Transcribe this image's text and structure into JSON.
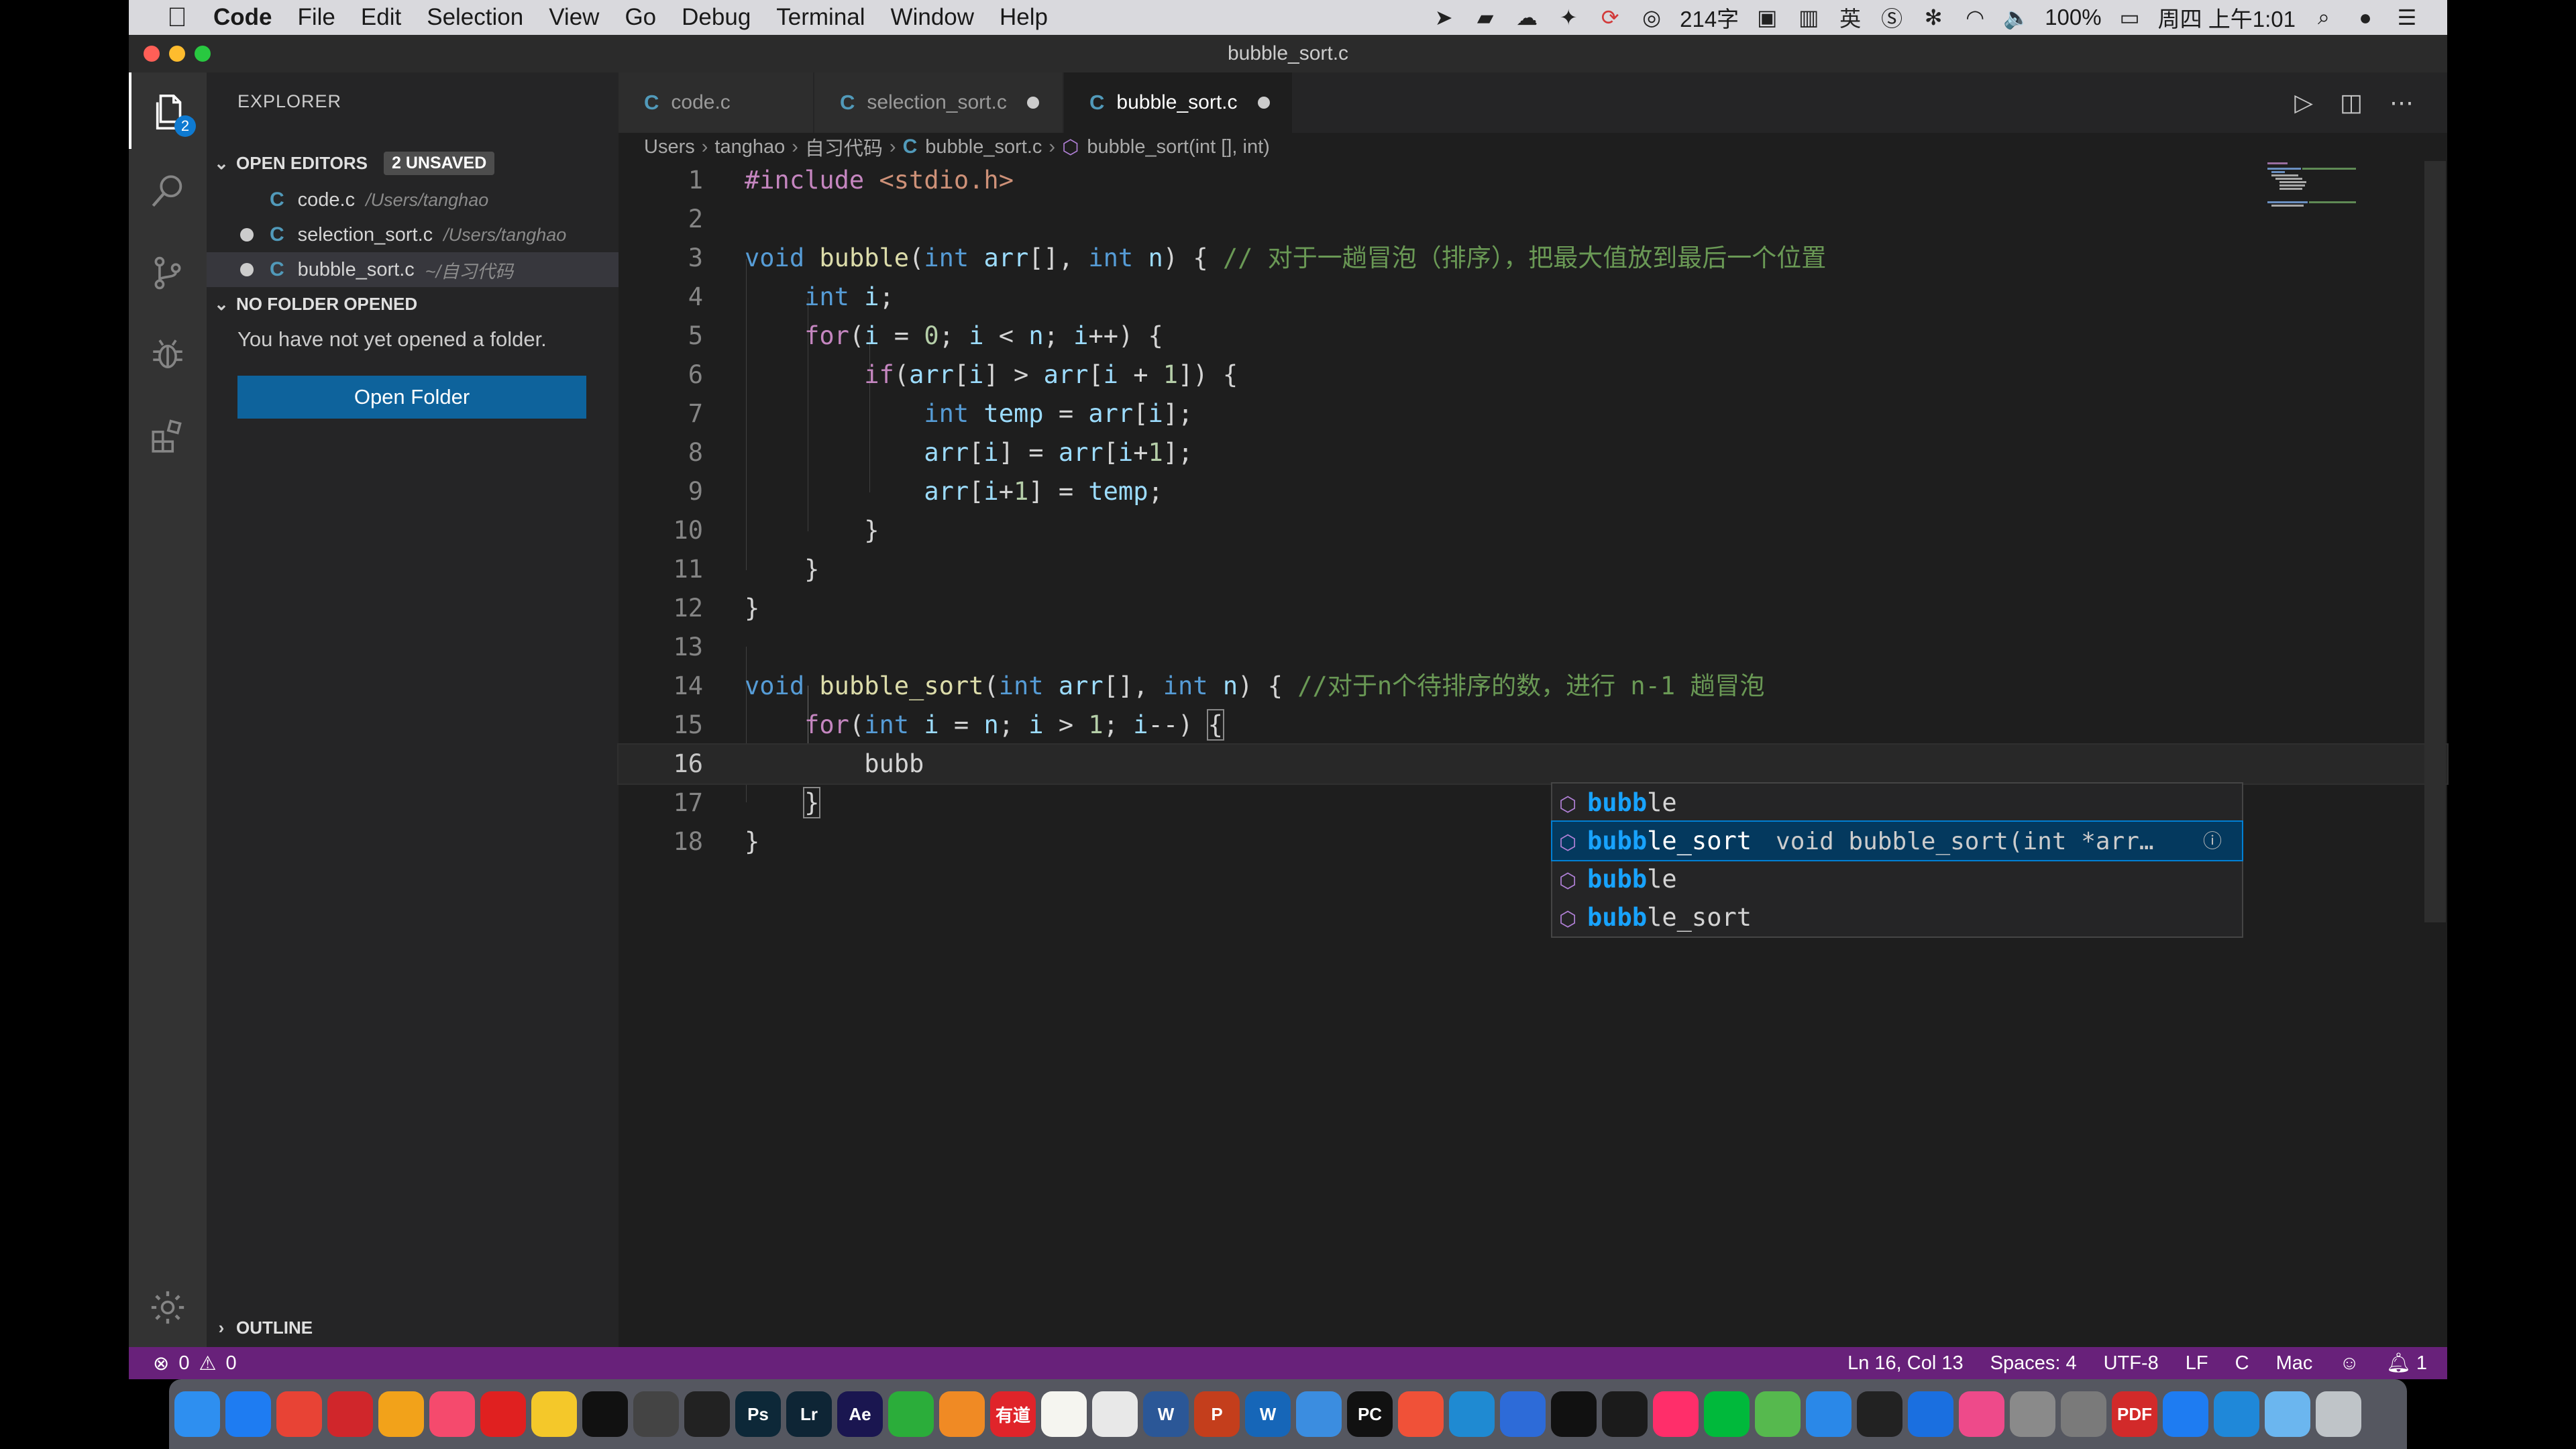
{
  "menubar": {
    "items": [
      "Code",
      "File",
      "Edit",
      "Selection",
      "View",
      "Go",
      "Debug",
      "Terminal",
      "Window",
      "Help"
    ],
    "status_text": "214字",
    "battery": "100%",
    "clock": "周四 上午1:01"
  },
  "window": {
    "title": "bubble_sort.c"
  },
  "activity": {
    "explorer_badge": "2"
  },
  "sidebar": {
    "title": "EXPLORER",
    "open_editors_label": "OPEN EDITORS",
    "unsaved_badge": "2 UNSAVED",
    "files": [
      {
        "letter": "C",
        "name": "code.c",
        "path": "/Users/tanghao",
        "unsaved": false
      },
      {
        "letter": "C",
        "name": "selection_sort.c",
        "path": "/Users/tanghao",
        "unsaved": true
      },
      {
        "letter": "C",
        "name": "bubble_sort.c",
        "path": "~/自习代码",
        "unsaved": true
      }
    ],
    "no_folder_label": "NO FOLDER OPENED",
    "no_folder_message": "You have not yet opened a folder.",
    "open_folder_button": "Open Folder",
    "outline_label": "OUTLINE"
  },
  "tabs": [
    {
      "letter": "C",
      "name": "code.c",
      "dirty": false,
      "active": false
    },
    {
      "letter": "C",
      "name": "selection_sort.c",
      "dirty": true,
      "active": false
    },
    {
      "letter": "C",
      "name": "bubble_sort.c",
      "dirty": true,
      "active": true
    }
  ],
  "breadcrumb": {
    "parts": [
      "Users",
      "tanghao",
      "自习代码"
    ],
    "file_letter": "C",
    "file": "bubble_sort.c",
    "symbol": "bubble_sort(int [], int)"
  },
  "code": {
    "line_numbers": [
      "1",
      "2",
      "3",
      "4",
      "5",
      "6",
      "7",
      "8",
      "9",
      "10",
      "11",
      "12",
      "13",
      "14",
      "15",
      "16",
      "17",
      "18"
    ],
    "current_line": 16
  },
  "suggest": {
    "typed": "bubb",
    "items": [
      {
        "match": "bubb",
        "rest": "le",
        "detail": ""
      },
      {
        "match": "bubb",
        "rest": "le_sort",
        "detail": "void bubble_sort(int *arr…"
      },
      {
        "match": "bubb",
        "rest": "le",
        "detail": ""
      },
      {
        "match": "bubb",
        "rest": "le_sort",
        "detail": ""
      }
    ],
    "selected_index": 1
  },
  "statusbar": {
    "errors": "0",
    "warnings": "0",
    "position": "Ln 16, Col 13",
    "spaces": "Spaces: 4",
    "encoding": "UTF-8",
    "eol": "LF",
    "language": "C",
    "platform": "Mac",
    "notifications": "1"
  },
  "dock": {
    "apps": [
      {
        "name": "Finder",
        "color": "#2e8ff0",
        "label": ""
      },
      {
        "name": "Safari",
        "color": "#1e7cf2",
        "label": ""
      },
      {
        "name": "Chrome",
        "color": "#e84335",
        "label": ""
      },
      {
        "name": "NetEase",
        "color": "#d0262b",
        "label": ""
      },
      {
        "name": "Photos",
        "color": "#f2a21a",
        "label": ""
      },
      {
        "name": "Music",
        "color": "#f54a6d",
        "label": ""
      },
      {
        "name": "NetEase Music",
        "color": "#e02020",
        "label": ""
      },
      {
        "name": "Maps",
        "color": "#f4c82a",
        "label": ""
      },
      {
        "name": "QQ",
        "color": "#111111",
        "label": ""
      },
      {
        "name": "Final Cut",
        "color": "#444444",
        "label": ""
      },
      {
        "name": "Screen",
        "color": "#222222",
        "label": ""
      },
      {
        "name": "Photoshop",
        "color": "#0d2838",
        "label": "Ps"
      },
      {
        "name": "Lightroom",
        "color": "#0e2535",
        "label": "Lr"
      },
      {
        "name": "After Effects",
        "color": "#1a1650",
        "label": "Ae"
      },
      {
        "name": "WeChat",
        "color": "#2bad3a",
        "label": ""
      },
      {
        "name": "Books",
        "color": "#f08a24",
        "label": ""
      },
      {
        "name": "Youdao",
        "color": "#e0242a",
        "label": "有道"
      },
      {
        "name": "Notes",
        "color": "#f5f5f0",
        "label": ""
      },
      {
        "name": "TextEdit",
        "color": "#e8e8e8",
        "label": ""
      },
      {
        "name": "Word",
        "color": "#2b5797",
        "label": "W"
      },
      {
        "name": "PowerPoint",
        "color": "#c43e1c",
        "label": "P"
      },
      {
        "name": "Outlook",
        "color": "#1666b8",
        "label": "W"
      },
      {
        "name": "Xcode",
        "color": "#3b8de0",
        "label": ""
      },
      {
        "name": "PyCharm",
        "color": "#111111",
        "label": "PC"
      },
      {
        "name": "Swift",
        "color": "#f05138",
        "label": ""
      },
      {
        "name": "VS Code",
        "color": "#1f8ad2",
        "label": ""
      },
      {
        "name": "Baidu",
        "color": "#2d6bd8",
        "label": ""
      },
      {
        "name": "Terminal",
        "color": "#111111",
        "label": ""
      },
      {
        "name": "Activity",
        "color": "#1b1b1b",
        "label": ""
      },
      {
        "name": "Youku",
        "color": "#ff2e6a",
        "label": ""
      },
      {
        "name": "iQIYI",
        "color": "#00b93b",
        "label": ""
      },
      {
        "name": "Infuse",
        "color": "#56b94e",
        "label": ""
      },
      {
        "name": "Mail",
        "color": "#2a88e8",
        "label": ""
      },
      {
        "name": "Pages",
        "color": "#222222",
        "label": ""
      },
      {
        "name": "TeamViewer",
        "color": "#1a6fe0",
        "label": ""
      },
      {
        "name": "CleanMyMac",
        "color": "#ee4a8a",
        "label": ""
      },
      {
        "name": "Rocket",
        "color": "#8a8a8a",
        "label": ""
      },
      {
        "name": "System Preferences",
        "color": "#7a7a7a",
        "label": ""
      },
      {
        "name": "PDF",
        "color": "#d22a2a",
        "label": "PDF"
      },
      {
        "name": "App Store",
        "color": "#1e7cf2",
        "label": ""
      },
      {
        "name": "Edge",
        "color": "#1f88d9",
        "label": ""
      },
      {
        "name": "Folder",
        "color": "#6bb6ef",
        "label": ""
      },
      {
        "name": "Trash",
        "color": "#bfc4c8",
        "label": ""
      }
    ]
  }
}
